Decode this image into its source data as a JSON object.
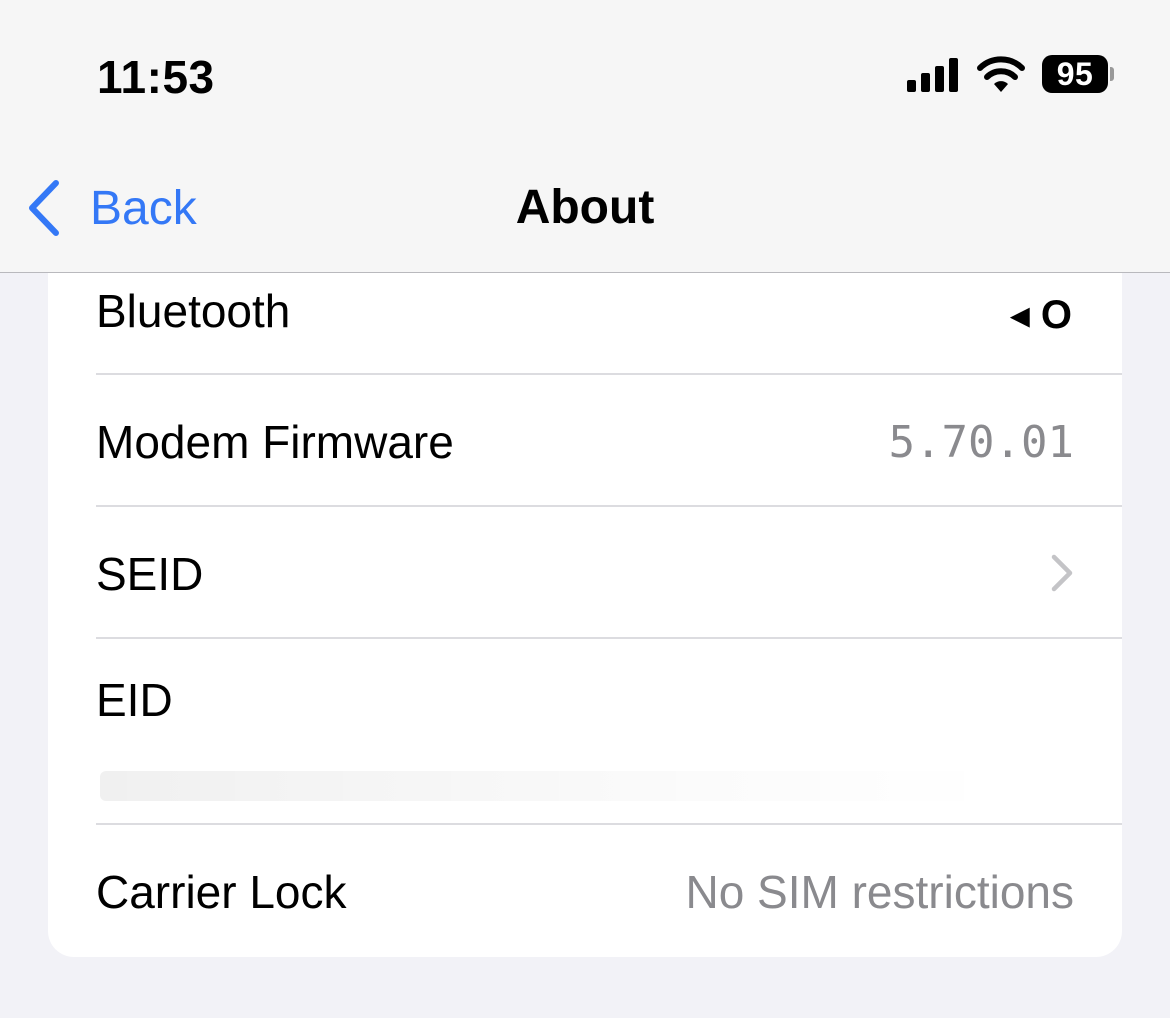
{
  "status_bar": {
    "time": "11:53",
    "battery": "95"
  },
  "nav": {
    "back_label": "Back",
    "title": "About"
  },
  "rows": [
    {
      "label": "Bluetooth",
      "value": "◂ O"
    },
    {
      "label": "Modem Firmware",
      "value": "5.70.01"
    },
    {
      "label": "SEID",
      "value": ""
    },
    {
      "label": "EID",
      "value": ""
    },
    {
      "label": "Carrier Lock",
      "value": "No SIM restrictions"
    }
  ],
  "colors": {
    "accent": "#3478f6",
    "secondary_text": "#8a8a8e",
    "background": "#f2f2f7"
  },
  "icons": [
    "signal-icon",
    "wifi-icon",
    "battery-icon",
    "back-chevron-icon",
    "chevron-right-icon"
  ]
}
